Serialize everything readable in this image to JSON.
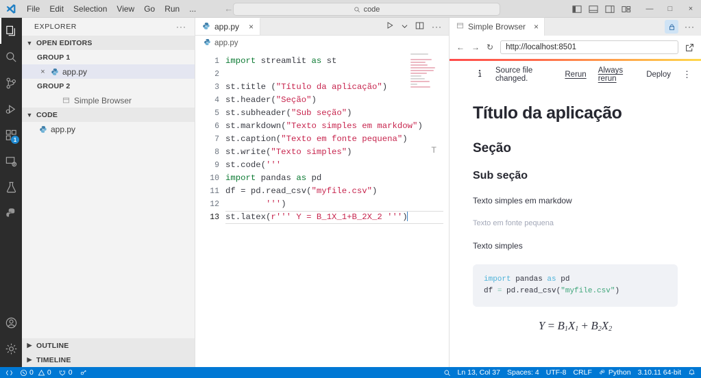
{
  "titlebar": {
    "menu": [
      "File",
      "Edit",
      "Selection",
      "View",
      "Go",
      "Run",
      "..."
    ],
    "command_center_text": "code",
    "window_buttons": {
      "minimize": "—",
      "maximize": "□",
      "close": "×"
    }
  },
  "activitybar": {
    "items": [
      {
        "name": "explorer",
        "icon": "files-icon"
      },
      {
        "name": "search",
        "icon": "search-icon"
      },
      {
        "name": "source-control",
        "icon": "source-control-icon"
      },
      {
        "name": "run-debug",
        "icon": "run-debug-icon"
      },
      {
        "name": "extensions",
        "icon": "extensions-icon",
        "badge": "1"
      },
      {
        "name": "remote-explorer",
        "icon": "remote-explorer-icon"
      },
      {
        "name": "testing",
        "icon": "testing-flask-icon"
      },
      {
        "name": "python",
        "icon": "python-icon"
      }
    ],
    "bottom": [
      {
        "name": "accounts",
        "icon": "account-icon"
      },
      {
        "name": "manage",
        "icon": "gear-icon"
      }
    ]
  },
  "sidebar": {
    "title": "EXPLORER",
    "more_actions": "···",
    "open_editors": {
      "label": "OPEN EDITORS",
      "groups": [
        {
          "label": "GROUP 1",
          "items": [
            {
              "label": "app.py",
              "icon": "python-file-icon",
              "selected": true,
              "close": "×"
            }
          ]
        },
        {
          "label": "GROUP 2",
          "items": [
            {
              "label": "Simple Browser",
              "icon": "browser-icon",
              "selected": false
            }
          ]
        }
      ]
    },
    "code_section": {
      "label": "CODE",
      "items": [
        {
          "label": "app.py",
          "icon": "python-file-icon"
        }
      ]
    },
    "bottom_sections": [
      "OUTLINE",
      "TIMELINE"
    ]
  },
  "editor": {
    "tab": {
      "label": "app.py",
      "icon": "python-file-icon",
      "close": "×"
    },
    "actions": [
      "run-icon",
      "chevron-down-icon",
      "split-editor-icon",
      "more-icon"
    ],
    "breadcrumb": "app.py",
    "line_numbers": [
      "1",
      "2",
      "3",
      "4",
      "5",
      "6",
      "7",
      "8",
      "9",
      "10",
      "11",
      "12",
      "13"
    ],
    "active_line": 13,
    "code_lines": [
      {
        "n": 1,
        "tokens": [
          {
            "t": "import",
            "c": "kw"
          },
          {
            "t": " streamlit ",
            "c": "plain"
          },
          {
            "t": "as",
            "c": "kw"
          },
          {
            "t": " st",
            "c": "plain"
          }
        ]
      },
      {
        "n": 2,
        "tokens": []
      },
      {
        "n": 3,
        "tokens": [
          {
            "t": "st.title (",
            "c": "plain"
          },
          {
            "t": "\"Título da aplicação\"",
            "c": "str"
          },
          {
            "t": ")",
            "c": "plain"
          }
        ]
      },
      {
        "n": 4,
        "tokens": [
          {
            "t": "st.header(",
            "c": "plain"
          },
          {
            "t": "\"Seção\"",
            "c": "str"
          },
          {
            "t": ")",
            "c": "plain"
          }
        ]
      },
      {
        "n": 5,
        "tokens": [
          {
            "t": "st.subheader(",
            "c": "plain"
          },
          {
            "t": "\"Sub seção\"",
            "c": "str"
          },
          {
            "t": ")",
            "c": "plain"
          }
        ]
      },
      {
        "n": 6,
        "tokens": [
          {
            "t": "st.markdown(",
            "c": "plain"
          },
          {
            "t": "\"Texto simples em markdow\"",
            "c": "str"
          },
          {
            "t": ")",
            "c": "plain"
          }
        ]
      },
      {
        "n": 7,
        "tokens": [
          {
            "t": "st.caption(",
            "c": "plain"
          },
          {
            "t": "\"Texto em fonte pequena\"",
            "c": "str"
          },
          {
            "t": ")",
            "c": "plain"
          }
        ]
      },
      {
        "n": 8,
        "tokens": [
          {
            "t": "st.write(",
            "c": "plain"
          },
          {
            "t": "\"Texto simples\"",
            "c": "str"
          },
          {
            "t": ")",
            "c": "plain"
          }
        ]
      },
      {
        "n": 9,
        "tokens": [
          {
            "t": "st.code(",
            "c": "plain"
          },
          {
            "t": "'''",
            "c": "str"
          }
        ]
      },
      {
        "n": 10,
        "tokens": [
          {
            "t": "import",
            "c": "kw"
          },
          {
            "t": " pandas ",
            "c": "plain"
          },
          {
            "t": "as",
            "c": "kw"
          },
          {
            "t": " pd",
            "c": "plain"
          }
        ]
      },
      {
        "n": 11,
        "tokens": [
          {
            "t": "df = pd.read_csv(",
            "c": "plain"
          },
          {
            "t": "\"myfile.csv\"",
            "c": "str"
          },
          {
            "t": ")",
            "c": "plain"
          }
        ]
      },
      {
        "n": 12,
        "tokens": [
          {
            "t": "        ",
            "c": "plain"
          },
          {
            "t": "'''",
            "c": "str"
          },
          {
            "t": ")",
            "c": "plain"
          }
        ]
      },
      {
        "n": 13,
        "tokens": [
          {
            "t": "st.latex(",
            "c": "plain"
          },
          {
            "t": "r",
            "c": "str"
          },
          {
            "t": "''' Y = B_1X_1+B_2X_2 '''",
            "c": "str"
          },
          {
            "t": ")",
            "c": "plain"
          }
        ]
      }
    ],
    "fold_marker": "T"
  },
  "browser": {
    "tab": {
      "label": "Simple Browser",
      "icon": "browser-icon",
      "close": "×"
    },
    "lock_icon": "lock-icon",
    "more_icon": "···",
    "nav": {
      "back": "←",
      "forward": "→",
      "reload": "↻"
    },
    "url": "http://localhost:8501",
    "open_external_icon": "external-link-icon"
  },
  "streamlit": {
    "toolbar": {
      "info_icon": "info-icon",
      "message": "Source file changed.",
      "rerun": "Rerun",
      "always_rerun": "Always rerun",
      "deploy": "Deploy",
      "menu_icon": "⋮"
    },
    "title": "Título da aplicação",
    "header": "Seção",
    "subheader": "Sub seção",
    "markdown": "Texto simples em markdow",
    "caption": "Texto em fonte pequena",
    "write": "Texto simples",
    "code_block": {
      "line1_kw": "import",
      "line1_rest": " pandas ",
      "line1_as": "as",
      "line1_tail": " pd",
      "line2_a": "df ",
      "line2_op": "=",
      "line2_b": " pd.read_csv(",
      "line2_str": "\"myfile.csv\"",
      "line2_c": ")"
    },
    "latex": {
      "y": "Y",
      "eq": "=",
      "b1": "B",
      "b1s": "1",
      "x1": "X",
      "x1s": "1",
      "plus": "+",
      "b2": "B",
      "b2s": "2",
      "x2": "X",
      "x2s": "2"
    }
  },
  "statusbar": {
    "left": [
      {
        "name": "remote-indicator",
        "icon": "remote-icon",
        "text": ""
      },
      {
        "name": "problems-errors",
        "icon": "error-icon",
        "text": "0"
      },
      {
        "name": "problems-warnings",
        "icon": "warning-icon",
        "text": "0"
      },
      {
        "name": "ports",
        "icon": "ports-icon",
        "text": "0"
      },
      {
        "name": "live-share",
        "icon": "live-share-icon",
        "text": ""
      }
    ],
    "right": [
      {
        "name": "search-status",
        "icon": "magnifier-icon",
        "text": ""
      },
      {
        "name": "cursor-position",
        "text": "Ln 13, Col 37"
      },
      {
        "name": "indentation",
        "text": "Spaces: 4"
      },
      {
        "name": "encoding",
        "text": "UTF-8"
      },
      {
        "name": "eol",
        "text": "CRLF"
      },
      {
        "name": "language-mode",
        "text": "Python",
        "icon": "python-status-icon"
      },
      {
        "name": "python-interpreter",
        "text": "3.10.11 64-bit"
      },
      {
        "name": "notifications",
        "icon": "bell-icon",
        "text": ""
      }
    ]
  },
  "colors": {
    "accent": "#0078d4",
    "streamlit_red": "#ff4b4b",
    "badge_blue": "#1f8ad2",
    "string_red": "#c7254e",
    "keyword_green": "#0c7a33"
  }
}
